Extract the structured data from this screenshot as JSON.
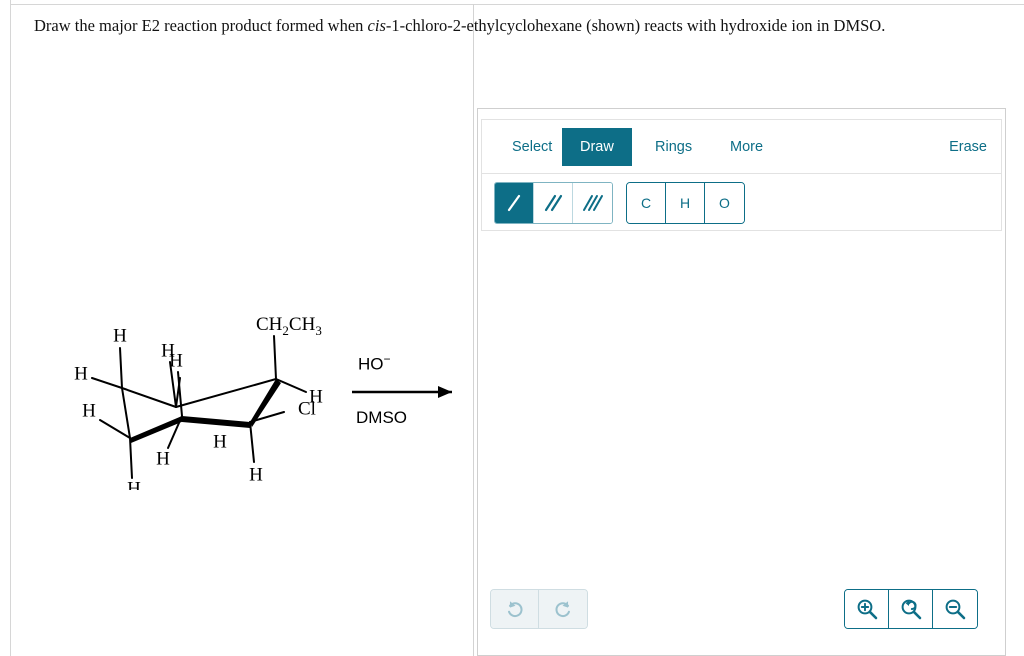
{
  "prompt": {
    "part1": "Draw the major E2 reaction product formed when ",
    "italic": "cis",
    "part2": "-1-chloro-2-ethylcyclohexane (shown) reacts with hydroxide ion in DMSO."
  },
  "reaction": {
    "reagent_above": "HO",
    "reagent_above_charge": "−",
    "solvent_below": "DMSO"
  },
  "molecule": {
    "name": "cis-1-chloro-2-ethylcyclohexane chair conformation",
    "substituents": [
      {
        "label": "CH",
        "sub1": "2",
        "label2": "CH",
        "sub2": "3"
      },
      {
        "label": "Cl"
      }
    ],
    "ethyl_label_main": "CH",
    "ethyl_sub_a": "2",
    "ethyl_label_main2": "CH",
    "ethyl_sub_b": "3",
    "chloro_label": "Cl",
    "hydrogen_label": "H",
    "hydrogen_count": 10
  },
  "toolbar": {
    "tabs": [
      {
        "label": "Select",
        "active": false
      },
      {
        "label": "Draw",
        "active": true
      },
      {
        "label": "Rings",
        "active": false
      },
      {
        "label": "More",
        "active": false
      }
    ],
    "erase_label": "Erase",
    "bond_tools": [
      {
        "name": "single-bond",
        "active": true
      },
      {
        "name": "double-bond",
        "active": false
      },
      {
        "name": "triple-bond",
        "active": false
      }
    ],
    "element_buttons": [
      {
        "label": "C"
      },
      {
        "label": "H"
      },
      {
        "label": "O"
      }
    ]
  },
  "controls": {
    "undo_label": "undo",
    "redo_label": "redo",
    "zoom_in_label": "zoom in",
    "zoom_reset_label": "reset zoom",
    "zoom_out_label": "zoom out"
  },
  "colors": {
    "accent": "#0d6e87",
    "accent_light": "#7fb4c2",
    "disabled": "#9cc2ce",
    "border": "#cfcfcf",
    "text": "#121212"
  }
}
